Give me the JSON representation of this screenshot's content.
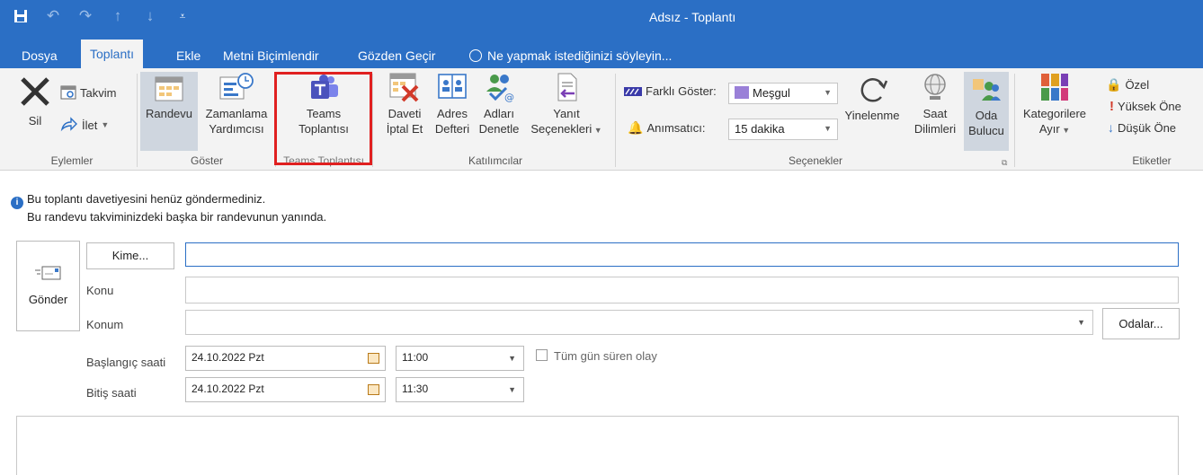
{
  "window": {
    "title": "Adsız - Toplantı"
  },
  "qat": {
    "save_icon": "save-icon",
    "undo_icon": "undo-icon",
    "redo_icon": "redo-icon",
    "up_icon": "up-arrow-icon",
    "down_icon": "down-arrow-icon",
    "more_icon": "customize-icon"
  },
  "tabs": {
    "dosya": "Dosya",
    "toplanti": "Toplantı",
    "ekle": "Ekle",
    "metni": "Metni Biçimlendir",
    "gozden": "Gözden Geçir",
    "tell": "Ne yapmak istediğinizi söyleyin..."
  },
  "ribbon": {
    "eylemler": {
      "label": "Eylemler",
      "sil": "Sil",
      "takvim": "Takvim",
      "ilet": "İlet"
    },
    "goster": {
      "label": "Göster",
      "randevu": "Randevu",
      "zaman1": "Zamanlama",
      "zaman2": "Yardımcısı"
    },
    "teams": {
      "label": "Teams Toplantısı",
      "l1": "Teams",
      "l2": "Toplantısı"
    },
    "katilimcilar": {
      "label": "Katılımcılar",
      "daveti1": "Daveti",
      "daveti2": "İptal Et",
      "adres1": "Adres",
      "adres2": "Defteri",
      "adlari1": "Adları",
      "adlari2": "Denetle",
      "yanit1": "Yanıt",
      "yanit2": "Seçenekleri"
    },
    "secenekler": {
      "label": "Seçenekler",
      "farkli": "Farklı Göster:",
      "farkli_value": "Meşgul",
      "animsatici": "Anımsatıcı:",
      "animsatici_value": "15 dakika",
      "yinelenme": "Yinelenme",
      "saat1": "Saat",
      "saat2": "Dilimleri",
      "oda1": "Oda",
      "oda2": "Bulucu"
    },
    "etiketler": {
      "label": "Etiketler",
      "kat1": "Kategorilere",
      "kat2": "Ayır",
      "ozel": "Özel",
      "yuksek": "Yüksek Öne",
      "dusuk": "Düşük Öne"
    }
  },
  "info": {
    "line1": "Bu toplantı davetiyesini henüz göndermediniz.",
    "line2": "Bu randevu takviminizdeki başka bir randevunun yanında."
  },
  "form": {
    "gonder": "Gönder",
    "kime": "Kime...",
    "konu": "Konu",
    "konum": "Konum",
    "odalar": "Odalar...",
    "baslangic": "Başlangıç saati",
    "bitis": "Bitiş saati",
    "start_date": "24.10.2022 Pzt",
    "start_time": "11:00",
    "end_date": "24.10.2022 Pzt",
    "end_time": "11:30",
    "allday": "Tüm gün süren olay"
  },
  "colors": {
    "accent": "#2b6fc5",
    "highlight": "#e02020"
  }
}
